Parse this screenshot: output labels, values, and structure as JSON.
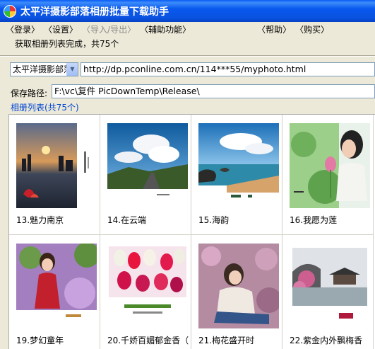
{
  "window": {
    "title": "太平洋摄影部落相册批量下载助手"
  },
  "menu": [
    {
      "label": "〈登录〉",
      "enabled": true
    },
    {
      "label": "〈设置〉",
      "enabled": true
    },
    {
      "label": "〈导入/导出〉",
      "enabled": false
    },
    {
      "label": "〈辅助功能〉",
      "enabled": true
    },
    {
      "label": "〈帮助〉",
      "enabled": true
    },
    {
      "label": "〈购买〉",
      "enabled": true
    }
  ],
  "status_text": "获取相册列表完成，共75个",
  "site_select": {
    "value": "太平洋摄影部落"
  },
  "url_input": {
    "value": "http://dp.pconline.com.cn/114***55/myphoto.html"
  },
  "save_path": {
    "label": "保存路径:",
    "value": "F:\\vc\\复件 PicDownTemp\\Release\\"
  },
  "album_group": {
    "label": "相册列表(共75个)"
  },
  "albums": [
    {
      "caption": "13.魅力南京",
      "icon": "city-sunset-photo"
    },
    {
      "caption": "14.在云端",
      "icon": "sky-clouds-road-photo"
    },
    {
      "caption": "15.海韵",
      "icon": "seaside-rocks-photo"
    },
    {
      "caption": "16.我愿为莲",
      "icon": "girl-lotus-photo"
    },
    {
      "caption": "19.梦幻童年",
      "icon": "child-flowers-photo"
    },
    {
      "caption": "20.千娇百媚郁金香（",
      "icon": "tulips-photo"
    },
    {
      "caption": "21.梅花盛开时",
      "icon": "girl-plum-blossom-photo"
    },
    {
      "caption": "22.紫金内外飘梅香",
      "icon": "garden-pavilion-photo"
    }
  ]
}
